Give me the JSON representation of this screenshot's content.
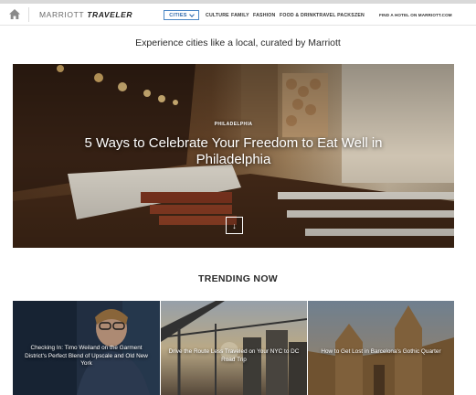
{
  "nav": {
    "brand_light": "MARRIOTT",
    "brand_bold": "TRAVELER",
    "cities_label": "CITIES",
    "links": [
      "CULTURE",
      "FAMILY",
      "FASHION",
      "FOOD & DRINK",
      "TRAVEL PACKS",
      "ZEN"
    ],
    "find_hotel": "FIND A HOTEL ON MARRIOTT.COM"
  },
  "tagline": "Experience cities like a local, curated by Marriott",
  "hero": {
    "kicker": "PHILADELPHIA",
    "title": "5 Ways to Celebrate Your Freedom to Eat Well in Philadelphia",
    "down_icon": "arrow-down-icon",
    "slides": 3,
    "active_slide": 1
  },
  "trending": {
    "heading": "TRENDING NOW",
    "cards": [
      {
        "title": "Checking In: Timo Weiland on the Garment District's Perfect Blend of Upscale and Old New York"
      },
      {
        "title": "Drive the Route Less Traveled on Your NYC to DC Road Trip"
      },
      {
        "title": "How to Get Lost in Barcelona's Gothic Quarter"
      }
    ]
  },
  "colors": {
    "accent": "#4a86c5",
    "text": "#2b2b2b"
  }
}
